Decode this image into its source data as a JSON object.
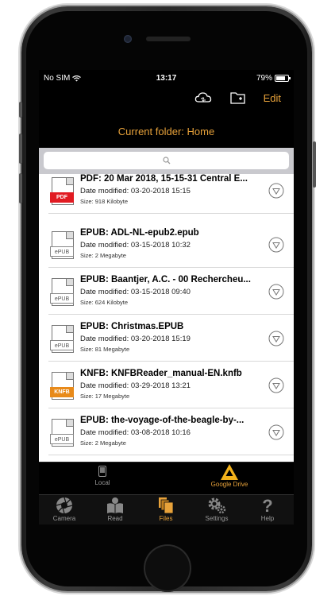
{
  "status": {
    "carrier": "No SIM",
    "time": "13:17",
    "battery": "79%",
    "battery_level": 0.79
  },
  "toolbar": {
    "edit_label": "Edit"
  },
  "header": {
    "folder_title": "Current folder: Home"
  },
  "search": {
    "placeholder": ""
  },
  "files": [
    {
      "type_tag": "PDF",
      "name": "PDF: 20 Mar 2018, 15-15-31 Central E...",
      "date": "Date modified: 03-20-2018 15:15",
      "size": "Size: 918 Kilobyte"
    },
    {
      "type_tag": "ePUB",
      "name": "EPUB: ADL-NL-epub2.epub",
      "date": "Date modified: 03-15-2018 10:32",
      "size": "Size: 2 Megabyte"
    },
    {
      "type_tag": "ePUB",
      "name": "EPUB: Baantjer, A.C. - 00 Rechercheu...",
      "date": "Date modified: 03-15-2018 09:40",
      "size": "Size: 624 Kilobyte"
    },
    {
      "type_tag": "ePUB",
      "name": "EPUB: Christmas.EPUB",
      "date": "Date modified: 03-20-2018 15:19",
      "size": "Size: 81 Megabyte"
    },
    {
      "type_tag": "KNFB",
      "name": "KNFB: KNFBReader_manual-EN.knfb",
      "date": "Date modified: 03-29-2018 13:21",
      "size": "Size: 17 Megabyte"
    },
    {
      "type_tag": "ePUB",
      "name": "EPUB: the-voyage-of-the-beagle-by-...",
      "date": "Date modified: 03-08-2018 10:16",
      "size": "Size: 2 Megabyte"
    }
  ],
  "sources": {
    "local": "Local",
    "google_drive": "Google Drive"
  },
  "tabs": {
    "camera": "Camera",
    "read": "Read",
    "files": "Files",
    "settings": "Settings",
    "help": "Help"
  },
  "colors": {
    "accent": "#e8a23a",
    "pdf_red": "#e11b22",
    "knfb_orange": "#e88a1a",
    "gdrive_yellow": "#f3b21b"
  }
}
